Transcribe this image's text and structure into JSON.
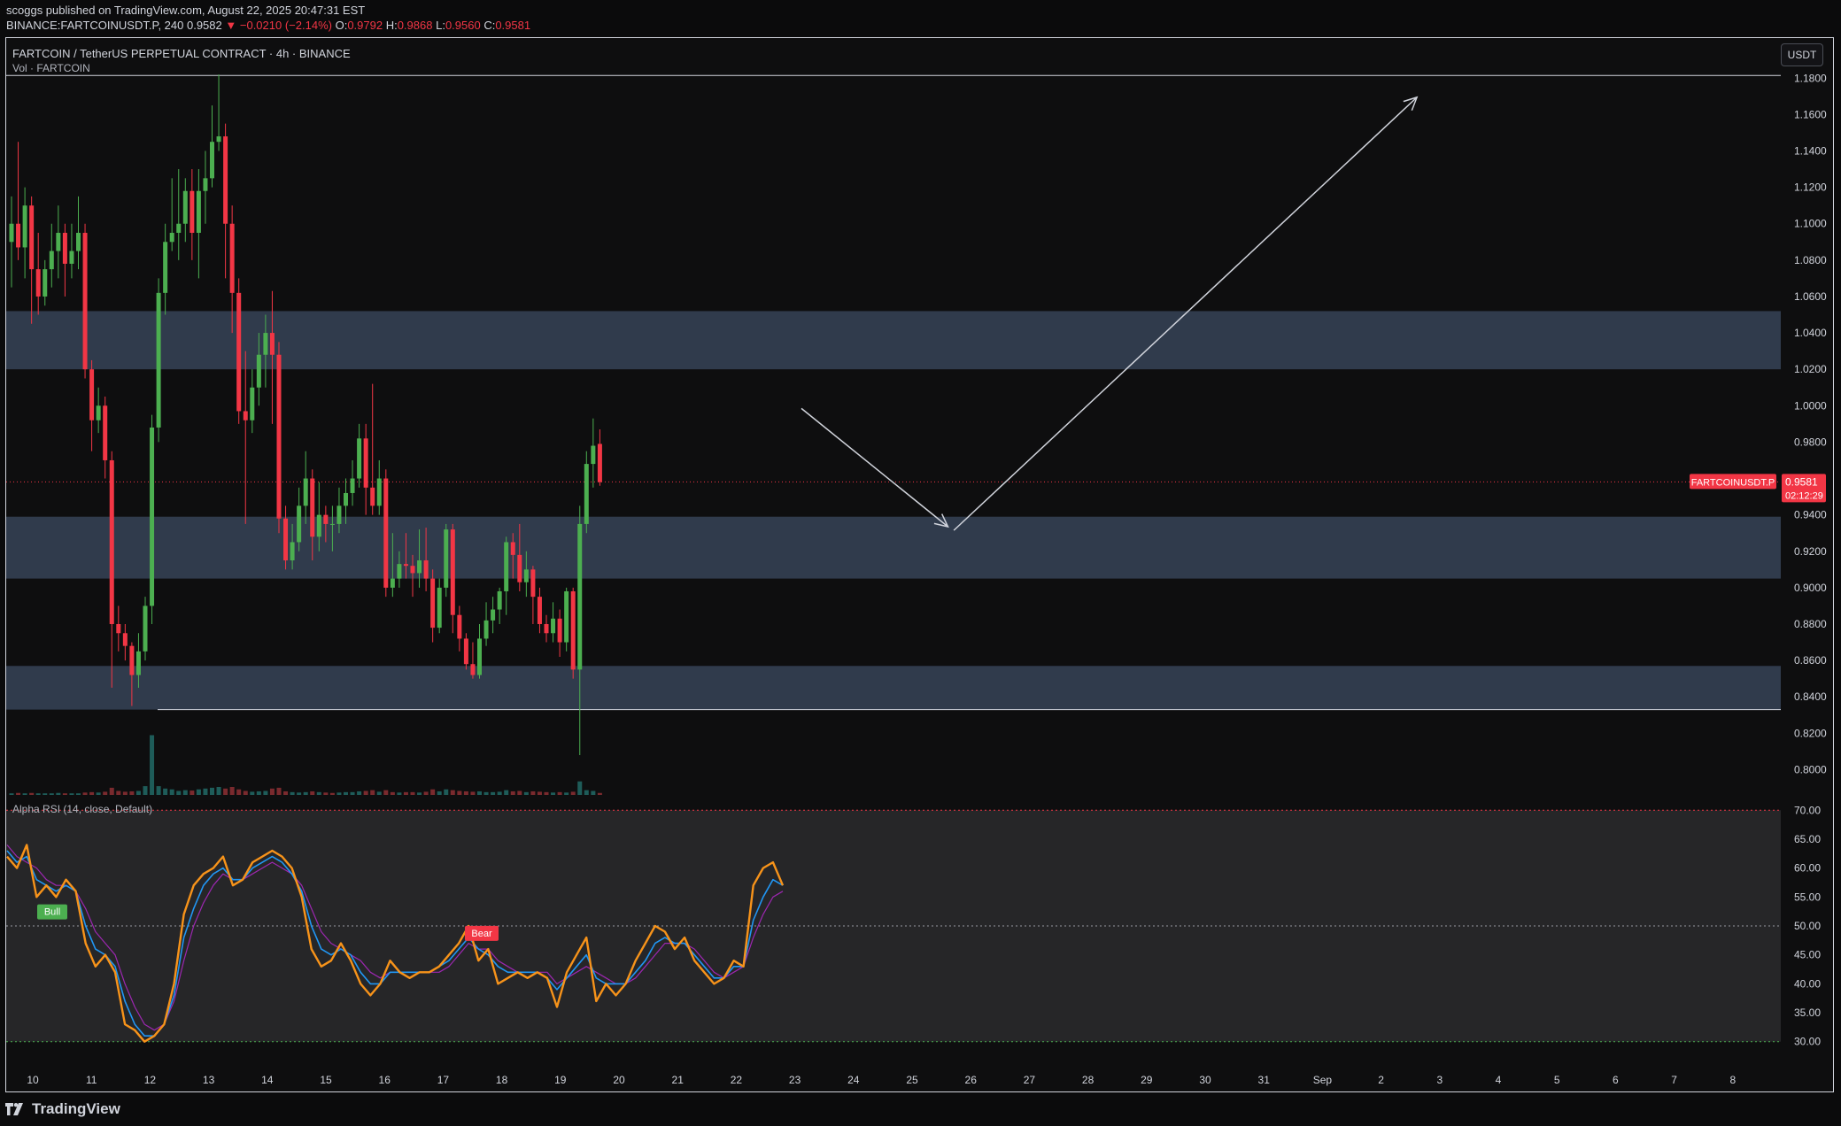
{
  "header": {
    "published": "scoggs published on TradingView.com, August 22, 2025 20:47:31 EST",
    "symbol_line": "BINANCE:FARTCOINUSDT.P, 240",
    "last": "0.9582",
    "change": "−0.0210 (−2.14%)",
    "o_label": "O:",
    "o": "0.9792",
    "h_label": "H:",
    "h": "0.9868",
    "l_label": "L:",
    "l": "0.9560",
    "c_label": "C:",
    "c": "0.9581"
  },
  "pane": {
    "title": "FARTCOIN / TetherUS PERPETUAL CONTRACT · 4h · BINANCE",
    "volume_label": "Vol · FARTCOIN",
    "currency": "USDT",
    "price_tag_symbol": "FARTCOINUSDT.P",
    "price_tag_value": "0.9581",
    "price_tag_timer": "02:12:29",
    "rsi_label": "Alpha RSI (14, close, Default)",
    "bull_label": "Bull",
    "bear_label": "Bear"
  },
  "footer": {
    "brand": "TradingView"
  },
  "colors": {
    "up": "#4caf50",
    "down": "#f23645",
    "zone": "#364357",
    "rsi_fast": "#f7931a",
    "rsi_mid": "#2196f3",
    "rsi_slow": "#9c27b0",
    "vol_up": "#1e5c59",
    "vol_down": "#7a2a2e"
  },
  "chart_data": [
    {
      "type": "candlestick",
      "timeframe": "4h",
      "y_ticks": [
        "1.1800",
        "1.1600",
        "1.1400",
        "1.1200",
        "1.1000",
        "1.0800",
        "1.0600",
        "1.0400",
        "1.0200",
        "1.0000",
        "0.9800",
        "0.9400",
        "0.9200",
        "0.9000",
        "0.8800",
        "0.8600",
        "0.8400",
        "0.8200",
        "0.8000"
      ],
      "x_ticks": [
        "10",
        "11",
        "12",
        "13",
        "14",
        "15",
        "16",
        "17",
        "18",
        "19",
        "20",
        "21",
        "22",
        "23",
        "24",
        "25",
        "26",
        "27",
        "28",
        "29",
        "30",
        "31",
        "Sep",
        "2",
        "3",
        "4",
        "5",
        "6",
        "7",
        "8"
      ],
      "ylim": [
        0.79,
        1.185
      ],
      "last_price": 0.9581,
      "zones": [
        [
          1.02,
          1.052
        ],
        [
          0.905,
          0.939
        ],
        [
          0.833,
          0.857
        ]
      ],
      "support_line": 0.833,
      "top_line": 1.1815,
      "candles": [
        [
          1.09,
          1.1,
          1.115,
          1.065
        ],
        [
          1.1,
          1.087,
          1.145,
          1.08
        ],
        [
          1.087,
          1.11,
          1.12,
          1.07
        ],
        [
          1.11,
          1.075,
          1.115,
          1.045
        ],
        [
          1.075,
          1.06,
          1.095,
          1.05
        ],
        [
          1.06,
          1.075,
          1.08,
          1.055
        ],
        [
          1.075,
          1.085,
          1.1,
          1.065
        ],
        [
          1.085,
          1.095,
          1.11,
          1.07
        ],
        [
          1.095,
          1.078,
          1.1,
          1.06
        ],
        [
          1.078,
          1.085,
          1.1,
          1.07
        ],
        [
          1.085,
          1.095,
          1.115,
          1.075
        ],
        [
          1.095,
          1.02,
          1.1,
          1.015
        ],
        [
          1.02,
          0.992,
          1.025,
          0.975
        ],
        [
          0.992,
          1.0,
          1.01,
          0.985
        ],
        [
          1.0,
          0.97,
          1.005,
          0.96
        ],
        [
          0.97,
          0.88,
          0.975,
          0.845
        ],
        [
          0.88,
          0.875,
          0.89,
          0.865
        ],
        [
          0.875,
          0.868,
          0.88,
          0.86
        ],
        [
          0.868,
          0.852,
          0.87,
          0.835
        ],
        [
          0.852,
          0.865,
          0.875,
          0.845
        ],
        [
          0.865,
          0.89,
          0.895,
          0.86
        ],
        [
          0.89,
          0.988,
          0.995,
          0.88
        ],
        [
          0.988,
          1.062,
          1.07,
          0.98
        ],
        [
          1.062,
          1.09,
          1.1,
          1.05
        ],
        [
          1.09,
          1.095,
          1.125,
          1.085
        ],
        [
          1.095,
          1.1,
          1.13,
          1.08
        ],
        [
          1.1,
          1.118,
          1.125,
          1.09
        ],
        [
          1.118,
          1.095,
          1.13,
          1.08
        ],
        [
          1.095,
          1.118,
          1.13,
          1.07
        ],
        [
          1.118,
          1.125,
          1.14,
          1.1
        ],
        [
          1.125,
          1.145,
          1.165,
          1.12
        ],
        [
          1.145,
          1.148,
          1.182,
          1.14
        ],
        [
          1.148,
          1.1,
          1.155,
          1.07
        ],
        [
          1.1,
          1.062,
          1.11,
          1.04
        ],
        [
          1.062,
          0.997,
          1.07,
          0.99
        ],
        [
          0.997,
          0.992,
          1.03,
          0.935
        ],
        [
          0.992,
          1.01,
          1.02,
          0.985
        ],
        [
          1.01,
          1.028,
          1.04,
          1.0
        ],
        [
          1.028,
          1.04,
          1.05,
          1.01
        ],
        [
          1.04,
          1.028,
          1.063,
          0.99
        ],
        [
          1.028,
          0.938,
          1.035,
          0.93
        ],
        [
          0.938,
          0.915,
          0.945,
          0.91
        ],
        [
          0.915,
          0.925,
          0.935,
          0.91
        ],
        [
          0.925,
          0.945,
          0.955,
          0.92
        ],
        [
          0.945,
          0.96,
          0.975,
          0.935
        ],
        [
          0.96,
          0.928,
          0.965,
          0.915
        ],
        [
          0.928,
          0.94,
          0.958,
          0.92
        ],
        [
          0.94,
          0.935,
          0.945,
          0.925
        ],
        [
          0.935,
          0.935,
          0.945,
          0.92
        ],
        [
          0.935,
          0.945,
          0.955,
          0.93
        ],
        [
          0.945,
          0.952,
          0.96,
          0.935
        ],
        [
          0.952,
          0.96,
          0.97,
          0.945
        ],
        [
          0.96,
          0.982,
          0.99,
          0.955
        ],
        [
          0.982,
          0.955,
          0.99,
          0.94
        ],
        [
          0.955,
          0.945,
          1.012,
          0.94
        ],
        [
          0.945,
          0.96,
          0.97,
          0.94
        ],
        [
          0.96,
          0.9,
          0.965,
          0.895
        ],
        [
          0.9,
          0.905,
          0.93,
          0.895
        ],
        [
          0.905,
          0.913,
          0.92,
          0.9
        ],
        [
          0.913,
          0.912,
          0.93,
          0.905
        ],
        [
          0.912,
          0.908,
          0.918,
          0.895
        ],
        [
          0.908,
          0.915,
          0.932,
          0.9
        ],
        [
          0.915,
          0.905,
          0.933,
          0.898
        ],
        [
          0.905,
          0.878,
          0.91,
          0.87
        ],
        [
          0.878,
          0.9,
          0.905,
          0.875
        ],
        [
          0.9,
          0.932,
          0.935,
          0.895
        ],
        [
          0.932,
          0.885,
          0.935,
          0.875
        ],
        [
          0.885,
          0.872,
          0.89,
          0.865
        ],
        [
          0.872,
          0.858,
          0.875,
          0.855
        ],
        [
          0.858,
          0.852,
          0.87,
          0.85
        ],
        [
          0.852,
          0.872,
          0.88,
          0.85
        ],
        [
          0.872,
          0.882,
          0.892,
          0.868
        ],
        [
          0.882,
          0.888,
          0.895,
          0.875
        ],
        [
          0.888,
          0.898,
          0.9,
          0.88
        ],
        [
          0.898,
          0.925,
          0.928,
          0.885
        ],
        [
          0.925,
          0.918,
          0.93,
          0.905
        ],
        [
          0.918,
          0.903,
          0.935,
          0.898
        ],
        [
          0.903,
          0.91,
          0.92,
          0.895
        ],
        [
          0.91,
          0.895,
          0.912,
          0.88
        ],
        [
          0.895,
          0.88,
          0.9,
          0.875
        ],
        [
          0.88,
          0.875,
          0.885,
          0.87
        ],
        [
          0.875,
          0.883,
          0.892,
          0.87
        ],
        [
          0.883,
          0.87,
          0.888,
          0.862
        ],
        [
          0.87,
          0.898,
          0.9,
          0.865
        ],
        [
          0.898,
          0.855,
          0.9,
          0.85
        ],
        [
          0.855,
          0.935,
          0.945,
          0.808
        ],
        [
          0.935,
          0.968,
          0.975,
          0.93
        ],
        [
          0.968,
          0.978,
          0.993,
          0.955
        ],
        [
          0.979,
          0.958,
          0.987,
          0.956
        ]
      ],
      "volume": [
        [
          4,
          0
        ],
        [
          5,
          1
        ],
        [
          4,
          0
        ],
        [
          5,
          1
        ],
        [
          4,
          0
        ],
        [
          4,
          0
        ],
        [
          4,
          0
        ],
        [
          5,
          0
        ],
        [
          4,
          1
        ],
        [
          4,
          0
        ],
        [
          4,
          0
        ],
        [
          6,
          1
        ],
        [
          7,
          1
        ],
        [
          6,
          0
        ],
        [
          8,
          1
        ],
        [
          18,
          1
        ],
        [
          10,
          1
        ],
        [
          8,
          1
        ],
        [
          9,
          1
        ],
        [
          10,
          0
        ],
        [
          22,
          0
        ],
        [
          150,
          0
        ],
        [
          22,
          0
        ],
        [
          16,
          0
        ],
        [
          14,
          0
        ],
        [
          10,
          0
        ],
        [
          12,
          0
        ],
        [
          11,
          1
        ],
        [
          14,
          0
        ],
        [
          16,
          0
        ],
        [
          18,
          0
        ],
        [
          20,
          0
        ],
        [
          16,
          1
        ],
        [
          20,
          1
        ],
        [
          14,
          1
        ],
        [
          10,
          1
        ],
        [
          8,
          0
        ],
        [
          9,
          0
        ],
        [
          10,
          0
        ],
        [
          16,
          1
        ],
        [
          18,
          1
        ],
        [
          9,
          1
        ],
        [
          7,
          0
        ],
        [
          6,
          0
        ],
        [
          7,
          0
        ],
        [
          9,
          1
        ],
        [
          7,
          0
        ],
        [
          6,
          1
        ],
        [
          5,
          1
        ],
        [
          6,
          0
        ],
        [
          7,
          0
        ],
        [
          7,
          0
        ],
        [
          9,
          0
        ],
        [
          10,
          1
        ],
        [
          12,
          1
        ],
        [
          8,
          0
        ],
        [
          12,
          1
        ],
        [
          7,
          1
        ],
        [
          6,
          0
        ],
        [
          7,
          1
        ],
        [
          7,
          1
        ],
        [
          6,
          0
        ],
        [
          8,
          1
        ],
        [
          14,
          1
        ],
        [
          9,
          0
        ],
        [
          14,
          0
        ],
        [
          12,
          1
        ],
        [
          10,
          1
        ],
        [
          9,
          1
        ],
        [
          8,
          1
        ],
        [
          9,
          0
        ],
        [
          7,
          0
        ],
        [
          7,
          0
        ],
        [
          8,
          0
        ],
        [
          12,
          0
        ],
        [
          9,
          1
        ],
        [
          10,
          1
        ],
        [
          7,
          0
        ],
        [
          9,
          1
        ],
        [
          8,
          1
        ],
        [
          7,
          1
        ],
        [
          6,
          0
        ],
        [
          7,
          1
        ],
        [
          6,
          0
        ],
        [
          8,
          1
        ],
        [
          34,
          0
        ],
        [
          12,
          0
        ],
        [
          10,
          0
        ],
        [
          5,
          1
        ]
      ],
      "drawings": [
        {
          "kind": "arrow",
          "from": [
            0.0,
            0.9985
          ],
          "to": [
            2.5,
            0.9335
          ],
          "note": "down leg"
        },
        {
          "kind": "arrow",
          "from": [
            2.6,
            0.9315
          ],
          "to": [
            10.5,
            1.1695
          ],
          "note": "up leg"
        }
      ]
    },
    {
      "type": "line",
      "name": "Alpha RSI (14, close, Default)",
      "y_ticks": [
        "70.00",
        "65.00",
        "60.00",
        "55.00",
        "50.00",
        "45.00",
        "40.00",
        "35.00",
        "30.00"
      ],
      "ylim": [
        29.5,
        70.5
      ],
      "levels": [
        70,
        50,
        30
      ],
      "series": [
        {
          "values": [
            62,
            60,
            64,
            55,
            57,
            55,
            58,
            56,
            47,
            43,
            45,
            42,
            33,
            32,
            30,
            31,
            33,
            40,
            52,
            57,
            59,
            60,
            62,
            57,
            58,
            61,
            62,
            63,
            62,
            60,
            55,
            46,
            43,
            44,
            47,
            44,
            40,
            38,
            40,
            44,
            42,
            41,
            42,
            42,
            43,
            45,
            47,
            50,
            44,
            46,
            40,
            41,
            42,
            41,
            42,
            41,
            36,
            42,
            45,
            48,
            37,
            40,
            38,
            40,
            44,
            47,
            50,
            49,
            46,
            48,
            44,
            42,
            40,
            41,
            44,
            43,
            57,
            60,
            61,
            57
          ]
        },
        {
          "values": [
            63,
            61,
            62,
            58,
            57,
            56,
            57,
            56,
            50,
            46,
            45,
            43,
            37,
            33,
            31,
            31,
            33,
            38,
            48,
            53,
            57,
            59,
            60,
            58,
            58,
            60,
            61,
            62,
            61,
            59,
            56,
            50,
            46,
            45,
            46,
            45,
            42,
            40,
            40,
            42,
            42,
            42,
            42,
            42,
            43,
            44,
            46,
            48,
            46,
            45,
            43,
            42,
            42,
            42,
            42,
            41,
            39,
            41,
            43,
            45,
            41,
            40,
            40,
            40,
            42,
            44,
            47,
            48,
            47,
            47,
            45,
            43,
            41,
            41,
            43,
            43,
            51,
            55,
            58,
            57
          ]
        },
        {
          "values": [
            64,
            62,
            61,
            60,
            58,
            57,
            57,
            56,
            53,
            49,
            47,
            45,
            40,
            36,
            33,
            32,
            33,
            37,
            44,
            50,
            54,
            57,
            59,
            58,
            58,
            59,
            60,
            61,
            60,
            59,
            57,
            53,
            49,
            47,
            46,
            45,
            44,
            42,
            41,
            42,
            42,
            42,
            42,
            42,
            42,
            43,
            45,
            47,
            46,
            46,
            44,
            43,
            42,
            42,
            42,
            42,
            40,
            41,
            42,
            43,
            42,
            41,
            40,
            40,
            41,
            43,
            45,
            47,
            47,
            47,
            46,
            44,
            42,
            41,
            42,
            43,
            48,
            52,
            55,
            56
          ]
        }
      ],
      "labels": [
        {
          "text": "Bull"
        },
        {
          "text": "Bear"
        }
      ]
    }
  ]
}
